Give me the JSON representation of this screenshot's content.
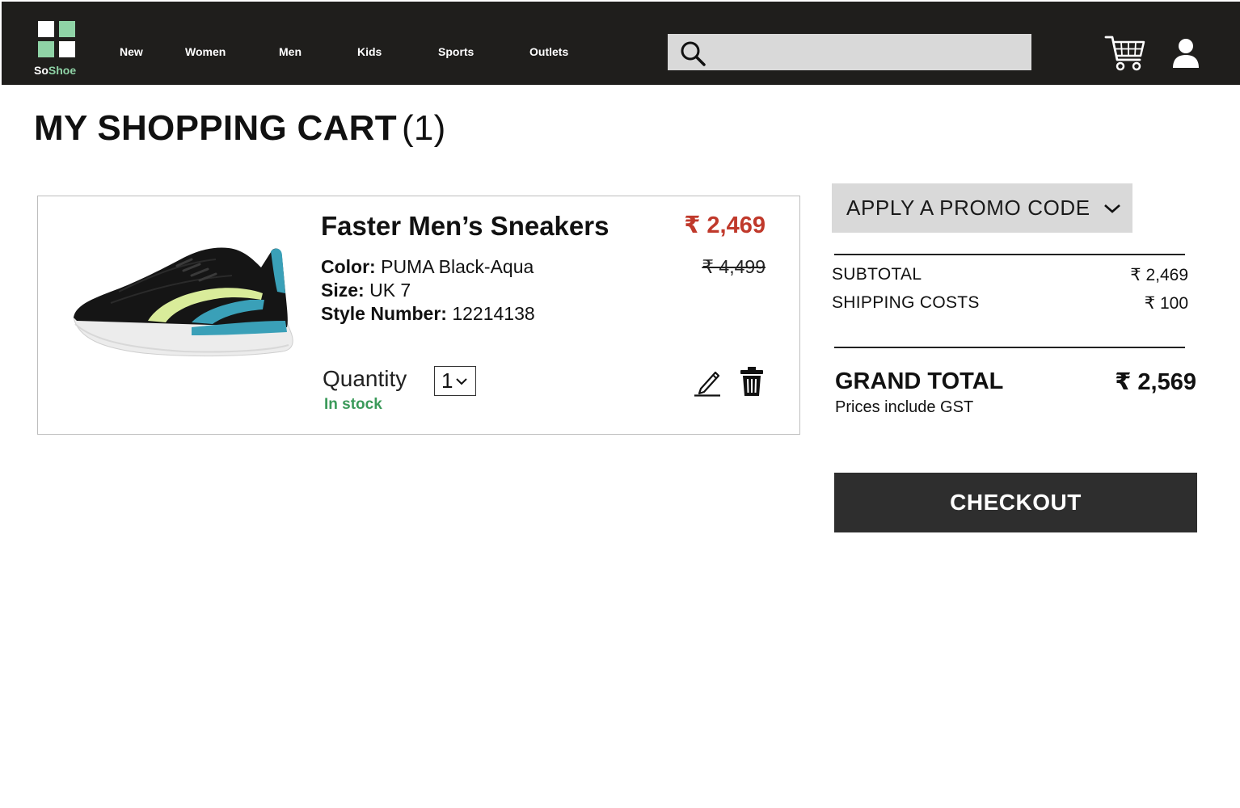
{
  "brand": {
    "name_part1": "So",
    "name_part2": "Shoe"
  },
  "nav": {
    "items": [
      {
        "label": "New"
      },
      {
        "label": "Women"
      },
      {
        "label": "Men"
      },
      {
        "label": "Kids"
      },
      {
        "label": "Sports"
      },
      {
        "label": "Outlets"
      }
    ]
  },
  "search": {
    "placeholder": "",
    "value": ""
  },
  "header_icons": {
    "search": "search-icon",
    "cart": "cart-icon",
    "user": "user-icon"
  },
  "page": {
    "title": "MY SHOPPING CART",
    "count": "(1)"
  },
  "cart": {
    "items": [
      {
        "name": "Faster Men’s Sneakers",
        "price": "₹ 2,469",
        "original_price": "₹ 4,499",
        "color_label": "Color:",
        "color_value": "PUMA Black-Aqua",
        "size_label": "Size:",
        "size_value": "UK 7",
        "style_label": "Style Number:",
        "style_value": "12214138",
        "quantity_label": "Quantity",
        "quantity_value": "1",
        "stock_status": "In stock"
      }
    ]
  },
  "summary": {
    "promo_label": "APPLY A PROMO CODE",
    "subtotal_label": "SUBTOTAL",
    "subtotal_value": "₹ 2,469",
    "shipping_label": "SHIPPING COSTS",
    "shipping_value": "₹ 100",
    "grand_total_label": "GRAND TOTAL",
    "grand_total_value": "₹ 2,569",
    "gst_note": "Prices include GST",
    "checkout_label": "CHECKOUT"
  },
  "colors": {
    "header_bg": "#1f1e1c",
    "brand_accent": "#8fd3a6",
    "sale_price": "#c0392b",
    "in_stock": "#3b9a5a",
    "checkout_bg": "#2e2e2e",
    "promo_bg": "#d9d9d9"
  }
}
